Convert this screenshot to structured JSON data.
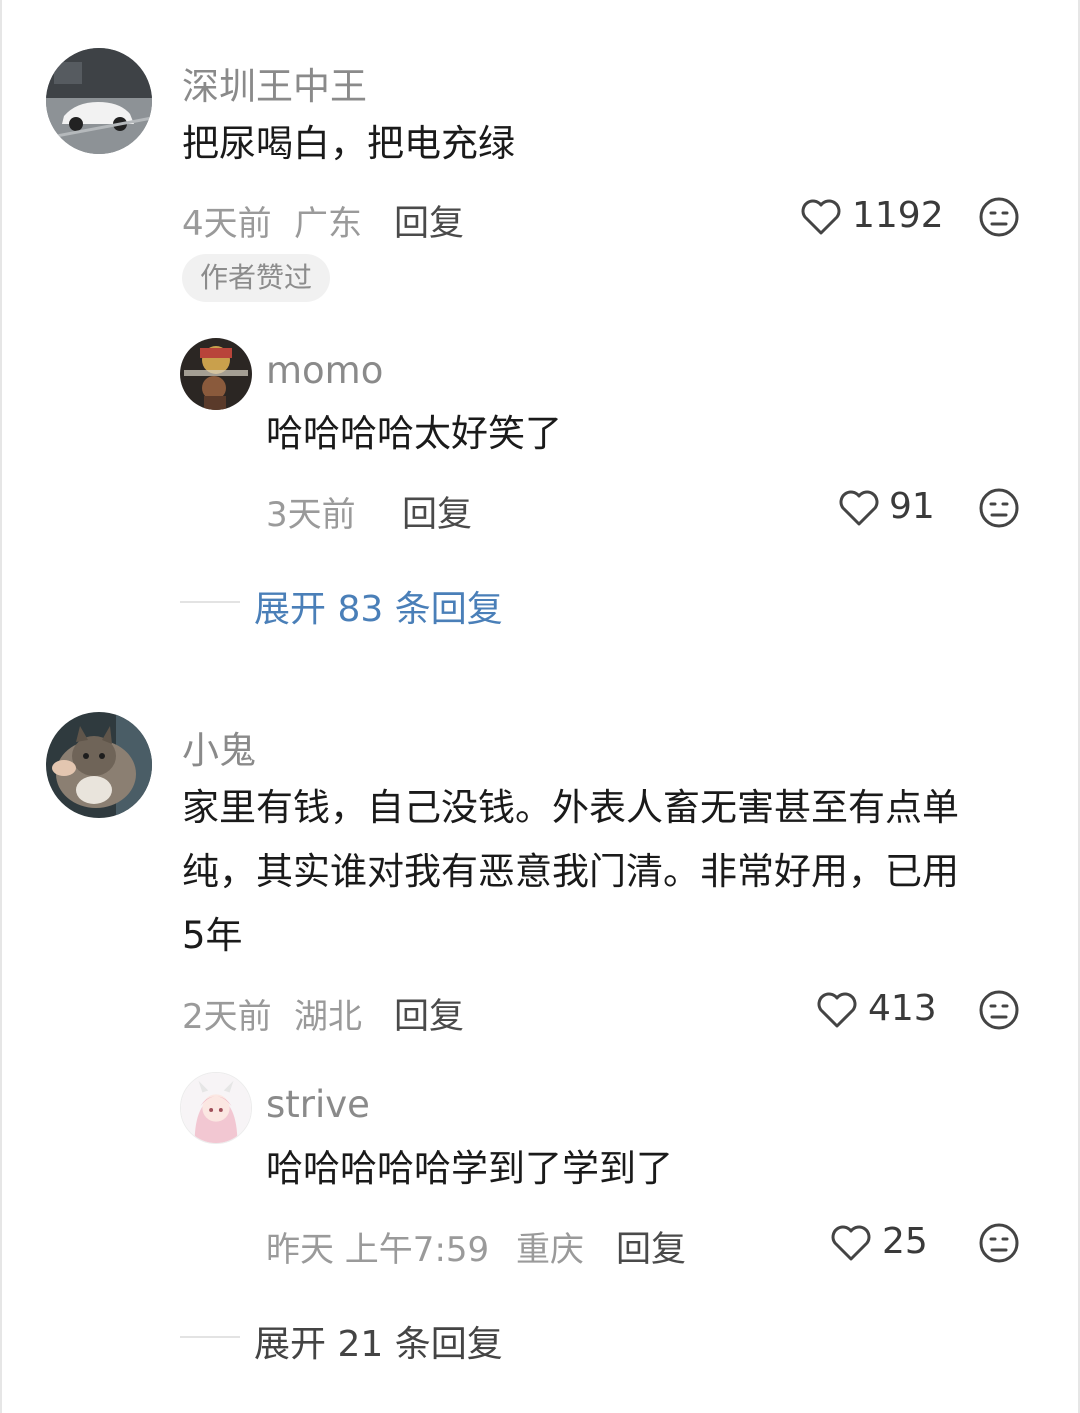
{
  "comments": [
    {
      "username": "深圳王中王",
      "content": "把尿喝白，把电充绿",
      "time": "4天前",
      "location": "广东",
      "reply_label": "回复",
      "likes": "1192",
      "author_badge": "作者赞过",
      "replies": [
        {
          "username": "momo",
          "content": "哈哈哈哈太好笑了",
          "time": "3天前",
          "reply_label": "回复",
          "likes": "91"
        }
      ],
      "expand_label": "展开 83 条回复"
    },
    {
      "username": "小鬼",
      "content_lines": [
        "家里有钱，自己没钱。外表人畜无害甚至有点单",
        "纯，其实谁对我有恶意我门清。非常好用，已用",
        "5年"
      ],
      "time": "2天前",
      "location": "湖北",
      "reply_label": "回复",
      "likes": "413",
      "replies": [
        {
          "username": "strive",
          "content": "哈哈哈哈哈学到了学到了",
          "time": "昨天 上午7:59",
          "location": "重庆",
          "reply_label": "回复",
          "likes": "25"
        }
      ],
      "expand_label": "展开 21 条回复"
    }
  ],
  "icons": {
    "like": "heart-outline-icon",
    "dislike": "neutral-face-icon"
  },
  "colors": {
    "expand_link": "#4a7fb8",
    "meta_text": "#9a9a9a",
    "username": "#8a8a8a"
  }
}
